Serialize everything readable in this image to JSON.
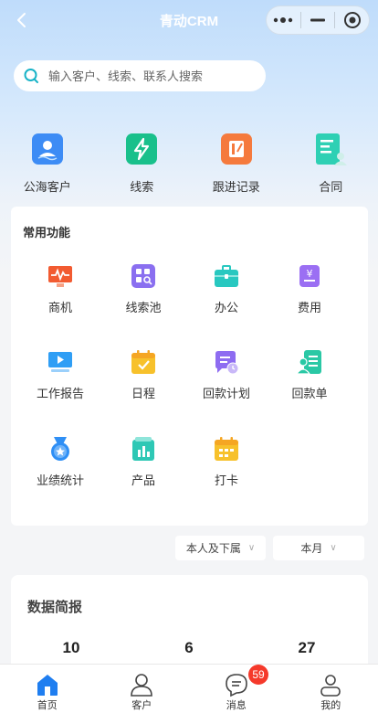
{
  "navbar": {
    "title": "青动CRM"
  },
  "search": {
    "placeholder": "输入客户、线索、联系人搜索"
  },
  "quick_links": [
    {
      "label": "公海客户",
      "icon": "sea-customer-icon",
      "color": "#3d8cf5"
    },
    {
      "label": "线索",
      "icon": "lightning-icon",
      "color": "#19c08b"
    },
    {
      "label": "跟进记录",
      "icon": "notebook-icon",
      "color": "#f57a3d"
    },
    {
      "label": "合同",
      "icon": "contract-icon",
      "color": "#2ed0b4"
    }
  ],
  "functions": {
    "title": "常用功能",
    "items": [
      {
        "label": "商机",
        "icon": "opportunity-icon",
        "color": "#f25b31"
      },
      {
        "label": "线索池",
        "icon": "lead-pool-icon",
        "color": "#8a6ff0"
      },
      {
        "label": "办公",
        "icon": "briefcase-icon",
        "color": "#28c8c0"
      },
      {
        "label": "费用",
        "icon": "expense-icon",
        "color": "#9b6ff3"
      },
      {
        "label": "工作报告",
        "icon": "report-icon",
        "color": "#2f9ef5"
      },
      {
        "label": "日程",
        "icon": "calendar-icon",
        "color": "#f7c12b"
      },
      {
        "label": "回款计划",
        "icon": "payment-plan-icon",
        "color": "#8e6cf1"
      },
      {
        "label": "回款单",
        "icon": "receipt-icon",
        "color": "#2ac8a5"
      },
      {
        "label": "业绩统计",
        "icon": "medal-icon",
        "color": "#2f8ff5"
      },
      {
        "label": "产品",
        "icon": "product-icon",
        "color": "#2ec8b5"
      },
      {
        "label": "打卡",
        "icon": "clock-in-icon",
        "color": "#f7c12b"
      }
    ]
  },
  "filters": {
    "scope": "本人及下属",
    "period": "本月"
  },
  "stats": {
    "title": "数据简报",
    "values": [
      "10",
      "6",
      "27"
    ]
  },
  "tabbar": {
    "items": [
      {
        "label": "首页",
        "active": true
      },
      {
        "label": "客户",
        "active": false
      },
      {
        "label": "消息",
        "active": false,
        "badge": "59"
      },
      {
        "label": "我的",
        "active": false
      }
    ]
  }
}
